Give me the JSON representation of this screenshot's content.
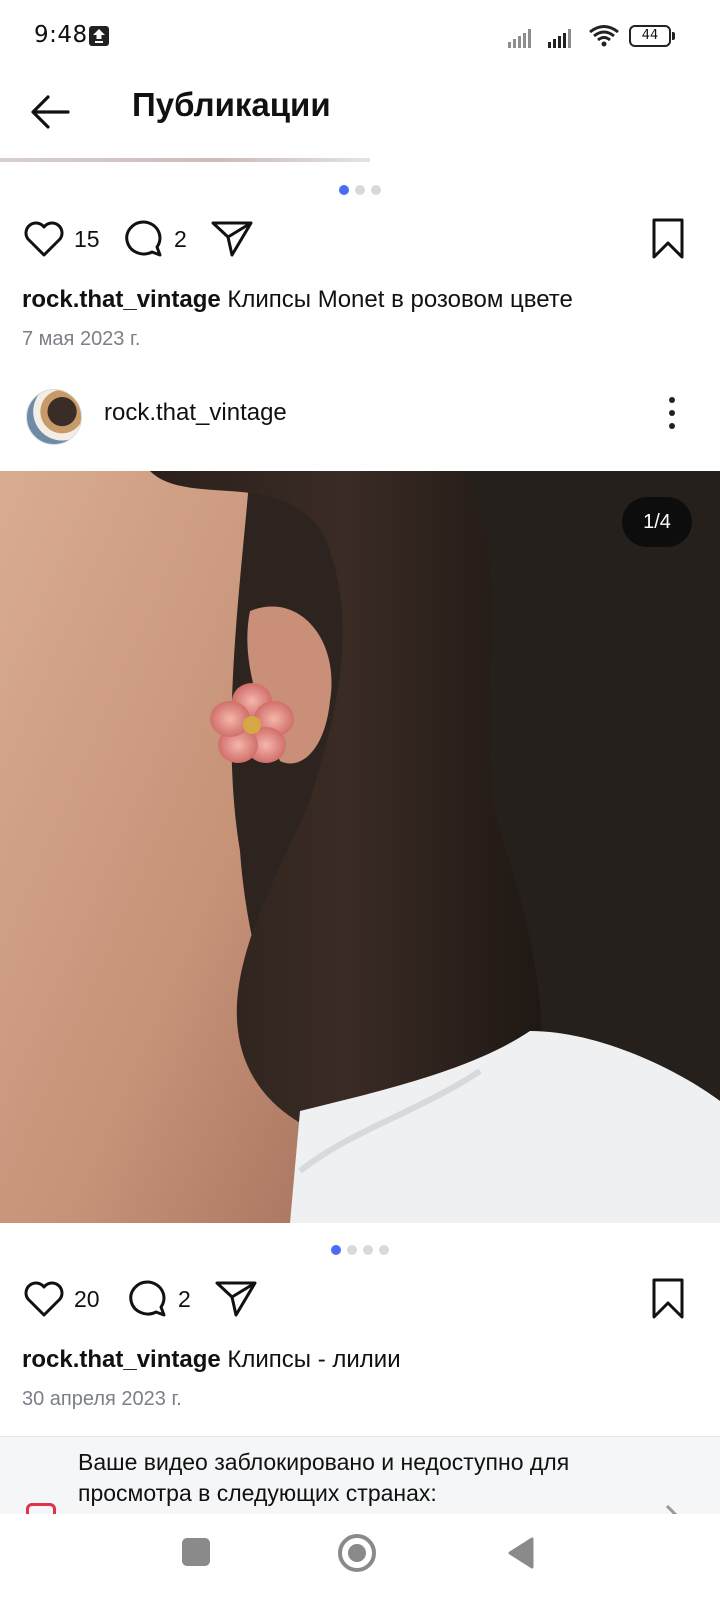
{
  "status_bar": {
    "time": "9:48",
    "battery": "44",
    "icons": [
      "upload-icon",
      "signal-icon",
      "signal-icon",
      "wifi-icon",
      "battery-icon"
    ]
  },
  "header": {
    "title": "Публикации",
    "back_icon": "arrow-left-icon"
  },
  "posts": [
    {
      "carousel_dots": 3,
      "active_dot": 0,
      "likes": "15",
      "comments": "2",
      "author": "rock.that_vintage",
      "caption": "Клипсы Monet в розовом цвете",
      "date": "7 мая 2023 г."
    },
    {
      "author": "rock.that_vintage",
      "image_counter": "1/4",
      "carousel_dots": 4,
      "active_dot": 0,
      "likes": "20",
      "comments": "2",
      "caption": "Клипсы - лилии",
      "date": "30 апреля 2023 г."
    }
  ],
  "banner": {
    "text": "Ваше видео заблокировано и недоступно для просмотра в следующих странах:"
  },
  "colors": {
    "accent_dot": "#4a6cf7",
    "date_gray": "#7b7f87",
    "banner_bg": "#f5f6f8",
    "banner_icon": "#e0324a"
  }
}
